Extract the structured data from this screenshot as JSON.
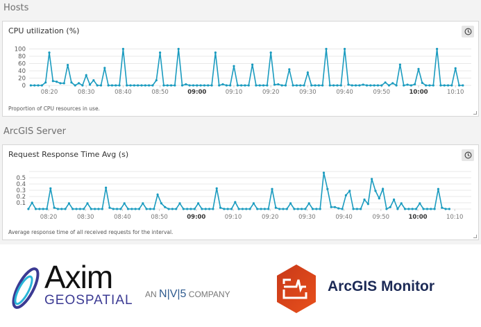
{
  "sections": [
    {
      "title": "Hosts"
    },
    {
      "title": "ArcGIS Server"
    }
  ],
  "chart_data": [
    {
      "type": "line",
      "title": "CPU utilization (%)",
      "description": "Proportion of CPU resources in use.",
      "x_start": "08:15",
      "x_step_minutes": 1,
      "x_ticks": [
        "08:20",
        "08:30",
        "08:40",
        "08:50",
        "09:00",
        "09:10",
        "09:20",
        "09:30",
        "09:40",
        "09:50",
        "10:00",
        "10:10"
      ],
      "bold_ticks": [
        "09:00",
        "10:00"
      ],
      "y_ticks": [
        "0",
        "20",
        "40",
        "60",
        "80",
        "100"
      ],
      "ylim": [
        0,
        100
      ],
      "grid": true,
      "color": "#1a9bbf",
      "values": [
        0,
        0,
        0,
        0,
        8,
        90,
        12,
        10,
        6,
        6,
        56,
        8,
        0,
        6,
        0,
        28,
        2,
        14,
        0,
        0,
        48,
        0,
        0,
        0,
        0,
        100,
        0,
        0,
        0,
        0,
        0,
        0,
        0,
        0,
        14,
        90,
        0,
        0,
        0,
        0,
        100,
        0,
        3,
        0,
        0,
        0,
        0,
        0,
        0,
        0,
        90,
        0,
        3,
        0,
        0,
        53,
        0,
        0,
        0,
        0,
        57,
        0,
        0,
        0,
        0,
        90,
        2,
        3,
        0,
        0,
        44,
        0,
        0,
        0,
        0,
        35,
        0,
        0,
        0,
        0,
        100,
        0,
        0,
        0,
        0,
        100,
        2,
        0,
        0,
        0,
        2,
        0,
        0,
        0,
        0,
        0,
        8,
        0,
        6,
        0,
        57,
        0,
        2,
        0,
        3,
        45,
        7,
        0,
        0,
        0,
        100,
        0,
        0,
        0,
        0,
        47,
        0,
        0
      ]
    },
    {
      "type": "line",
      "title": "Request Response Time Avg (s)",
      "description": "Average response time of all received requests for the interval.",
      "x_start": "08:15",
      "x_step_minutes": 1,
      "x_ticks": [
        "08:20",
        "08:30",
        "08:40",
        "08:50",
        "09:00",
        "09:10",
        "09:20",
        "09:30",
        "09:40",
        "09:50",
        "10:00",
        "10:10"
      ],
      "bold_ticks": [
        "09:00",
        "10:00"
      ],
      "y_ticks": [
        "0.1",
        "0.2",
        "0.3",
        "0.4",
        "0.5"
      ],
      "ylim": [
        0,
        0.6
      ],
      "grid": true,
      "color": "#1a9bbf",
      "values": [
        0,
        0.1,
        0,
        0,
        0,
        0,
        0.33,
        0.02,
        0,
        0,
        0,
        0.09,
        0,
        0,
        0,
        0,
        0.09,
        0,
        0,
        0,
        0,
        0.34,
        0.02,
        0,
        0,
        0,
        0.09,
        0,
        0,
        0,
        0,
        0.09,
        0,
        0,
        0,
        0.23,
        0.09,
        0.03,
        0,
        0,
        0,
        0.09,
        0,
        0,
        0,
        0,
        0.09,
        0,
        0,
        0,
        0,
        0.33,
        0.02,
        0,
        0,
        0,
        0.11,
        0,
        0,
        0,
        0,
        0.09,
        0,
        0,
        0,
        0,
        0.32,
        0.02,
        0,
        0,
        0,
        0.09,
        0,
        0,
        0,
        0,
        0.09,
        0,
        0,
        0,
        0.58,
        0.32,
        0.03,
        0.03,
        0.01,
        0,
        0.22,
        0.29,
        0,
        0,
        0,
        0.15,
        0.08,
        0.48,
        0.29,
        0.17,
        0.32,
        0,
        0.03,
        0.15,
        0,
        0.09,
        0,
        0,
        0,
        0,
        0.09,
        0,
        0,
        0,
        0,
        0.32,
        0.02,
        0,
        0
      ]
    }
  ],
  "logos": {
    "axim": {
      "word": "Axim",
      "sub": "GEOSPATIAL",
      "tag_prefix": "AN",
      "tag_nv5": "N|V|5",
      "tag_suffix": "COMPANY"
    },
    "arcgis": {
      "text": "ArcGIS Monitor"
    }
  },
  "icons": {
    "clock": "clock-icon"
  }
}
